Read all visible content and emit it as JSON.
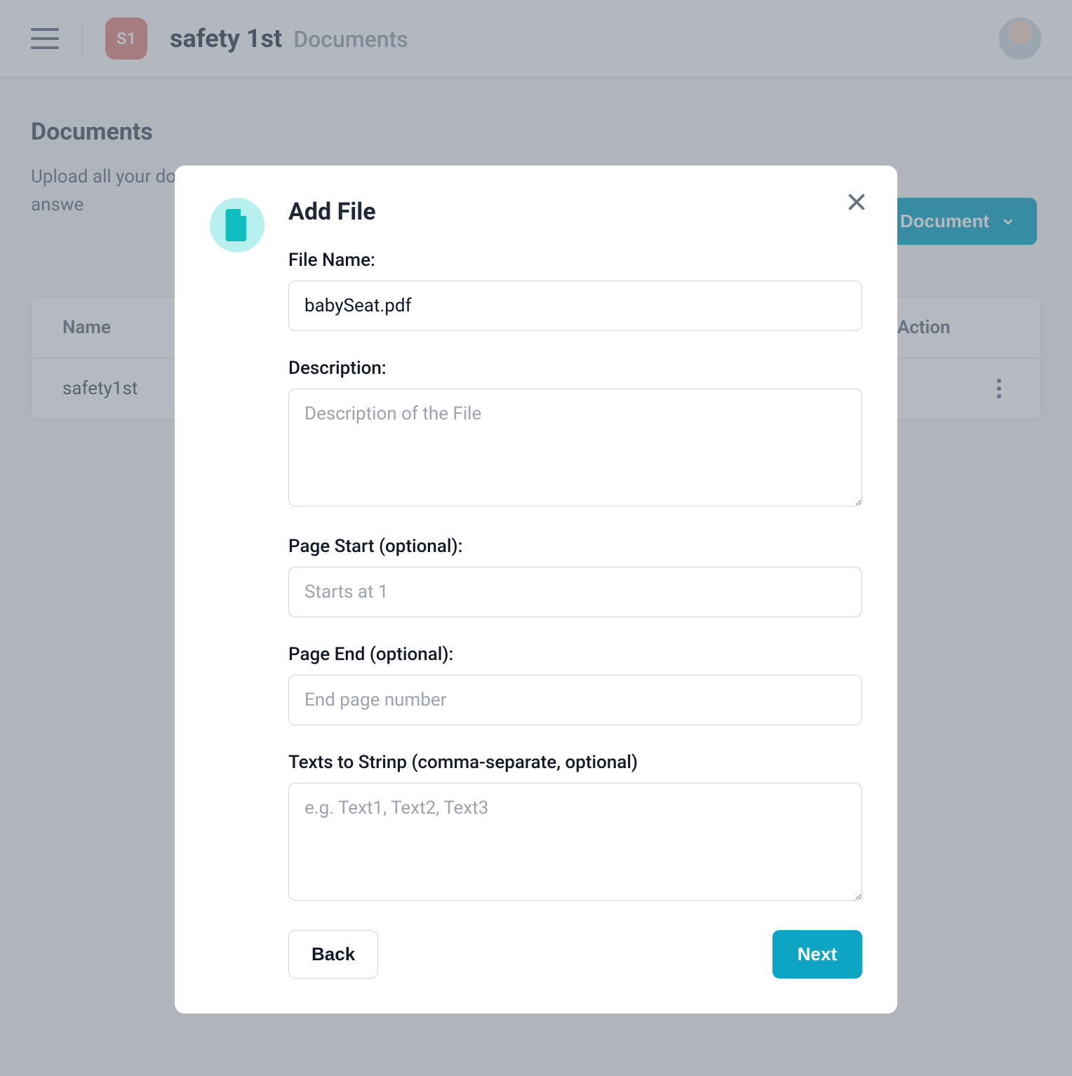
{
  "header": {
    "org_badge": "S1",
    "org_name": "safety 1st",
    "section": "Documents"
  },
  "page": {
    "title": "Documents",
    "subtitle": "Upload all your documentation, URLs), or an en copilot to answe",
    "add_button": "+ Add Document"
  },
  "table": {
    "columns": {
      "name": "Name",
      "action": "Action"
    },
    "rows": [
      {
        "name": "safety1st"
      }
    ]
  },
  "modal": {
    "title": "Add File",
    "fields": {
      "file_name": {
        "label": "File Name:",
        "value": "babySeat.pdf"
      },
      "description": {
        "label": "Description:",
        "placeholder": "Description of the File"
      },
      "page_start": {
        "label": "Page Start (optional):",
        "placeholder": "Starts at 1"
      },
      "page_end": {
        "label": "Page End (optional):",
        "placeholder": "End page number"
      },
      "texts_strip": {
        "label": "Texts to Strinp (comma-separate, optional)",
        "placeholder": "e.g. Text1, Text2, Text3"
      }
    },
    "buttons": {
      "back": "Back",
      "next": "Next"
    }
  }
}
